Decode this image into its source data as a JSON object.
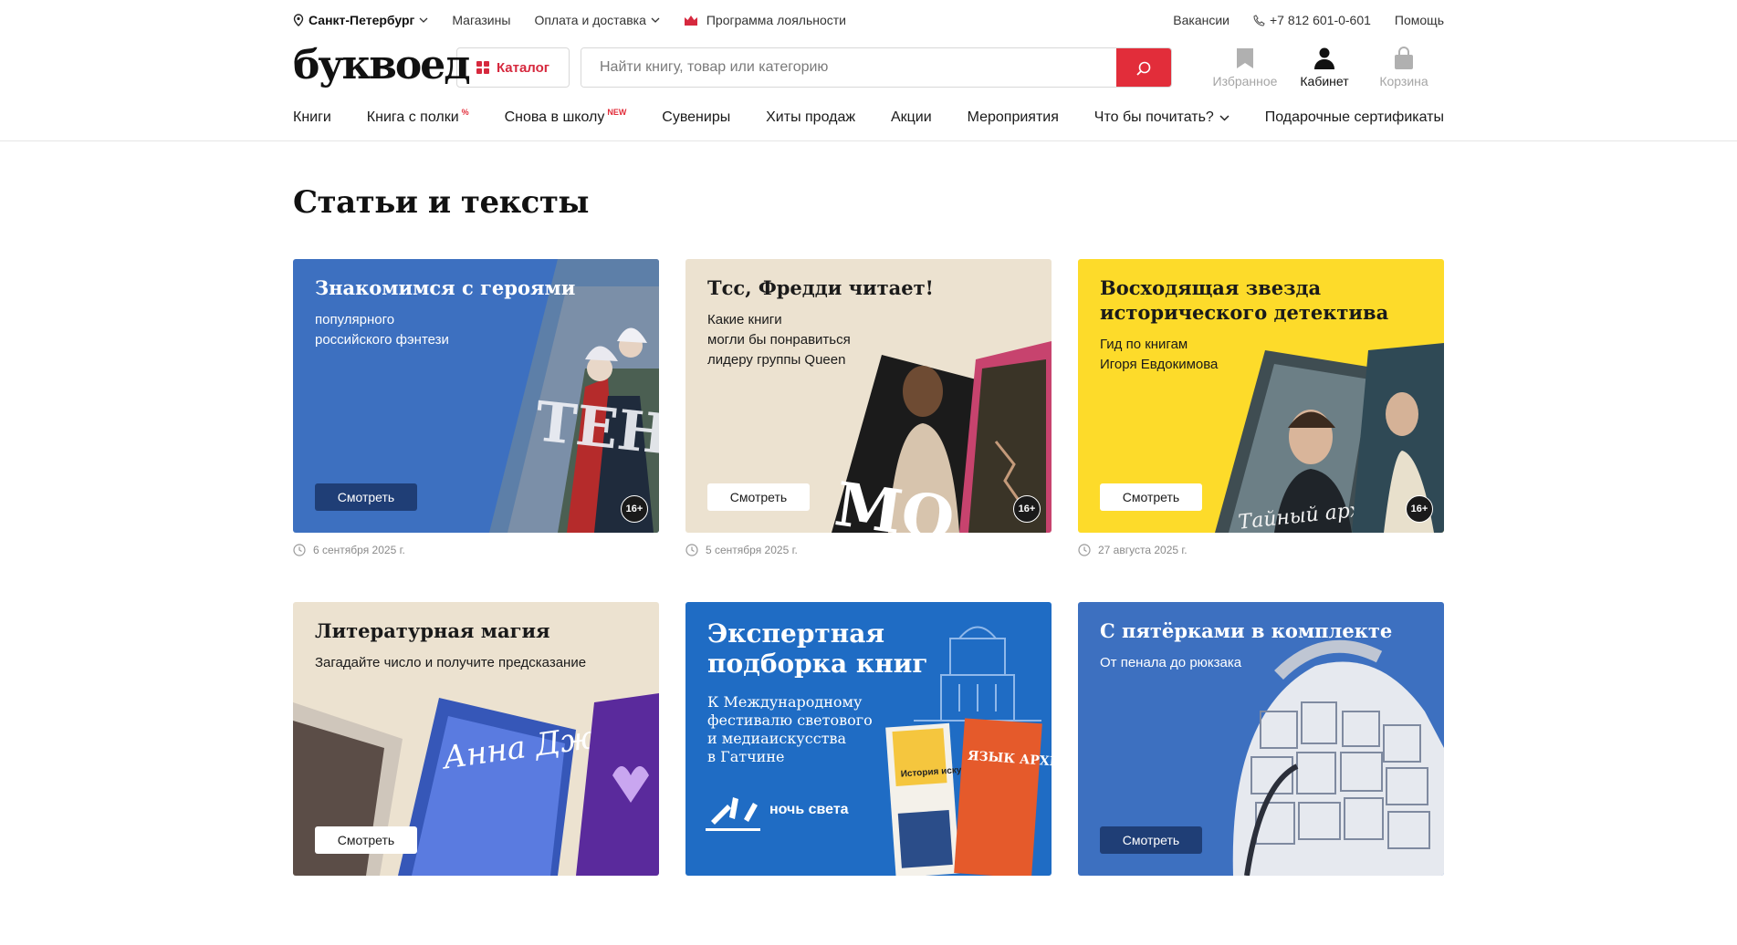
{
  "topbar": {
    "city": "Санкт-Петербург",
    "links": [
      "Магазины",
      "Оплата и доставка",
      "Программа лояльности"
    ],
    "vacancies": "Вакансии",
    "phone": "+7 812 601-0-601",
    "help": "Помощь"
  },
  "header": {
    "logo": "буквоед",
    "catalog": "Каталог",
    "search_placeholder": "Найти книгу, товар или категорию",
    "favorites": "Избранное",
    "cabinet": "Кабинет",
    "cart": "Корзина"
  },
  "nav": {
    "items": [
      "Книги",
      "Книга с полки",
      "Снова в школу",
      "Сувениры",
      "Хиты продаж",
      "Акции",
      "Мероприятия",
      "Что бы почитать?",
      "Подарочные сертификаты"
    ],
    "badge_percent": "%",
    "badge_new": "NEW"
  },
  "page_title": "Статьи и тексты",
  "cards": [
    {
      "title": "Знакомимся с героями",
      "subtitle": "популярного\nроссийского фэнтези",
      "button": "Смотреть",
      "age": "16+",
      "date": "6 сентября 2025 г.",
      "art_text": "ТЕНЬ"
    },
    {
      "title": "Тсс, Фредди читает!",
      "subtitle": "Какие книги\nмогли бы понравиться\nлидеру группы Queen",
      "button": "Смотреть",
      "age": "16+",
      "date": "5 сентября 2025 г.",
      "art_text": "МОДА"
    },
    {
      "title": "Восходящая звезда исторического детектива",
      "subtitle": "Гид по книгам\nИгоря Евдокимова",
      "button": "Смотреть",
      "age": "16+",
      "date": "27 августа 2025 г.",
      "art_text": "Тайный архив Корсакова"
    },
    {
      "title": "Литературная магия",
      "subtitle": "Загадайте число и получите предсказание",
      "button": "Смотреть",
      "art_text": "Анна Джейн"
    },
    {
      "title": "Экспертная подборка книг",
      "subtitle": "К Международному\nфестивалю светового\nи медиаискусства\nв Гатчине",
      "logo_text": "ночь света",
      "art_text": "ЯЗЫК АРХИТЕКТУРЫ",
      "art_text2": "История искусств"
    },
    {
      "title": "С пятёрками в комплекте",
      "subtitle": "От пенала до рюкзака",
      "button": "Смотреть"
    }
  ]
}
